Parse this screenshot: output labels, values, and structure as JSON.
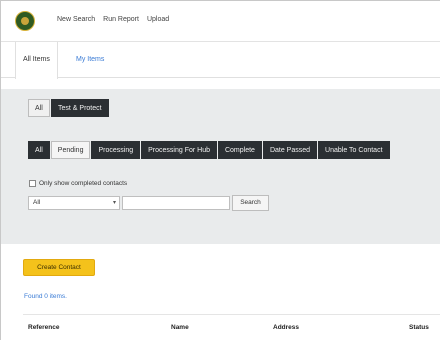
{
  "nav": {
    "links": [
      "New Search",
      "Run Report",
      "Upload"
    ]
  },
  "tabs": {
    "all_items": "All Items",
    "my_items": "My Items"
  },
  "scope": {
    "all_label": "All",
    "test_protect_label": "Test & Protect"
  },
  "status_filters": [
    "All",
    "Pending",
    "Processing",
    "Processing For Hub",
    "Complete",
    "Date Passed",
    "Unable To Contact"
  ],
  "options": {
    "only_completed_label": "Only show completed contacts",
    "select_value": "All",
    "search_text": "",
    "search_button": "Search"
  },
  "actions": {
    "create_contact": "Create Contact"
  },
  "results": {
    "found_text": "Found 0 items."
  },
  "table": {
    "headers": [
      "Reference",
      "Name",
      "Address",
      "Status"
    ]
  },
  "colors": {
    "accent_yellow": "#f4c21b",
    "dark_pill": "#2b2f33",
    "link_blue": "#3a7bd5",
    "panel_gray": "#e9ebec"
  }
}
